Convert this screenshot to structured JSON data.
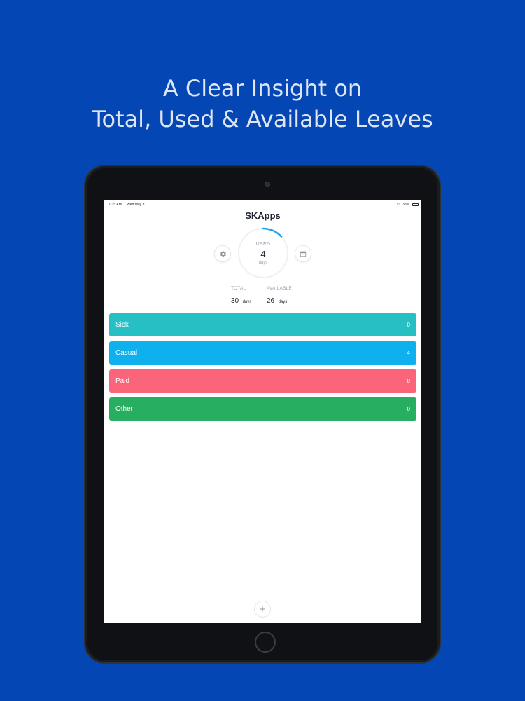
{
  "headline": {
    "line1": "A Clear Insight on",
    "line2": "Total, Used & Available Leaves"
  },
  "status_bar": {
    "time": "11:15 AM",
    "date": "Wed May 8",
    "battery": "36%"
  },
  "app": {
    "title": "SKApps"
  },
  "summary": {
    "used_label": "USED",
    "used_value": "4",
    "used_unit": "days",
    "used_fraction": 0.133,
    "total_label": "TOTAL",
    "total_value": "30",
    "total_unit": "days",
    "available_label": "AVAILABLE",
    "available_value": "26",
    "available_unit": "days"
  },
  "leaves": [
    {
      "name": "Sick",
      "count": "0",
      "color": "#26bfc4"
    },
    {
      "name": "Casual",
      "count": "4",
      "color": "#0fb0ee"
    },
    {
      "name": "Paid",
      "count": "0",
      "color": "#fb657c"
    },
    {
      "name": "Other",
      "count": "0",
      "color": "#27ae60"
    }
  ],
  "icons": {
    "settings": "gear-icon",
    "calendar": "calendar-icon",
    "add": "plus-icon"
  },
  "colors": {
    "background": "#0447b4",
    "ring_progress": "#1aa3e8",
    "ring_track": "#eef0f2"
  },
  "add_button": {
    "symbol": "+"
  }
}
